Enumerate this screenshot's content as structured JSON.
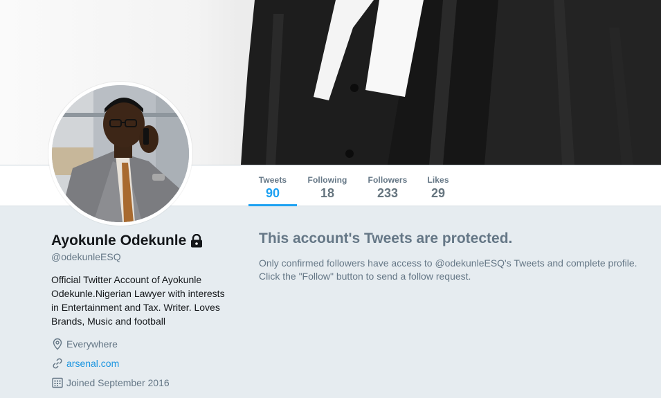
{
  "profile": {
    "name": "Ayokunle Odekunle",
    "handle": "@odekunleESQ",
    "bio": "Official Twitter Account of Ayokunle Odekunle.Nigerian Lawyer with interests in Entertainment and Tax. Writer. Loves Brands, Music and football",
    "location": "Everywhere",
    "website": "arsenal.com",
    "joined": "Joined September 2016"
  },
  "nav": {
    "tweets": {
      "label": "Tweets",
      "value": "90"
    },
    "following": {
      "label": "Following",
      "value": "18"
    },
    "followers": {
      "label": "Followers",
      "value": "233"
    },
    "likes": {
      "label": "Likes",
      "value": "29"
    }
  },
  "protected": {
    "title": "This account's Tweets are protected.",
    "body": "Only confirmed followers have access to @odekunleESQ's Tweets and complete profile. Click the \"Follow\" button to send a follow request."
  },
  "icons": {
    "lock": "lock-icon",
    "location": "location-pin-icon",
    "link": "link-icon",
    "calendar": "calendar-icon"
  },
  "colors": {
    "accent": "#1da1f2",
    "link": "#1b95e0",
    "muted": "#657786",
    "background": "#e6ecf0"
  }
}
